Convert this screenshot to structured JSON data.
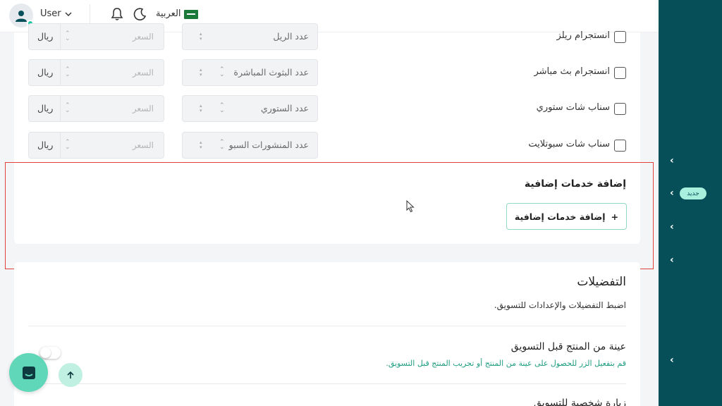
{
  "header": {
    "user_name": "User",
    "language": "العربية"
  },
  "sidebar": {
    "badge": "جديد",
    "chevron": "‹"
  },
  "services": [
    {
      "label": "انستجرام ريلز",
      "count_placeholder": "عدد الريل",
      "price_placeholder": "السعر",
      "currency": "ريال"
    },
    {
      "label": "انستجرام بث مباشر",
      "count_placeholder": "عدد البثوث المباشرة",
      "price_placeholder": "السعر",
      "currency": "ريال"
    },
    {
      "label": "سناب شات ستوري",
      "count_placeholder": "عدد الستوري",
      "price_placeholder": "السعر",
      "currency": "ريال"
    },
    {
      "label": "سناب شات سبوتلايت",
      "count_placeholder": "عدد المنشورات السبو",
      "price_placeholder": "السعر",
      "currency": "ريال"
    }
  ],
  "extra": {
    "title": "إضافة خدمات إضافية",
    "button_label": "إضافة خدمات إضافية",
    "plus": "+"
  },
  "preferences": {
    "title": "التفضيلات",
    "subtitle": "اضبط التفضيلات والإعدادات للتسويق.",
    "sample_title": "عينة من المنتج قبل التسويق",
    "sample_desc": "قم بتفعيل الزر للحصول على عينة من المنتج أو تجريب المنتج قبل التسويق.",
    "visit_title": "زيارة شخصية للتسويق"
  },
  "colors": {
    "sidebar": "#064f58",
    "accent": "#5fd7b8",
    "highlight": "#e0413a"
  }
}
